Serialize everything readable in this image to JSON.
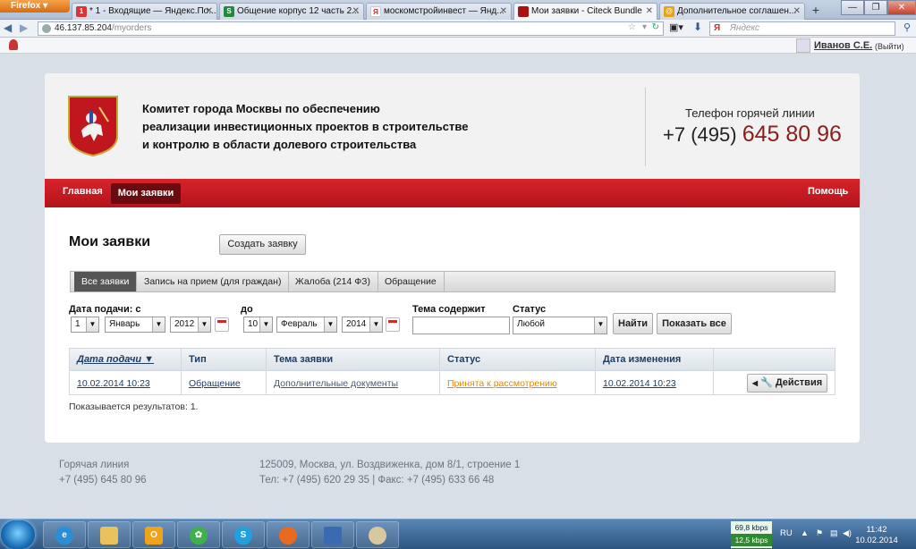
{
  "browser": {
    "app_button": "Firefox",
    "tabs": [
      {
        "title": "* 1 - Входящие — Яндекс.По...",
        "icon": "yandex-mail-icon"
      },
      {
        "title": "Общение корпус 12 часть 2...",
        "icon": "green-s-icon"
      },
      {
        "title": "москомстройинвест — Янд...",
        "icon": "yandex-icon"
      },
      {
        "title": "Мои заявки - Citeck Bundle",
        "icon": "moscow-crest-icon"
      },
      {
        "title": "Дополнительное соглашен...",
        "icon": "at-icon"
      }
    ],
    "new_tab": "+",
    "url_host": "46.137.85.204",
    "url_path": "/myorders",
    "search_placeholder": "Яндекс",
    "user_name": "Иванов С.Е.",
    "logout": "(Выйти)"
  },
  "site": {
    "org_lines": [
      "Комитет города Москвы по обеспечению",
      "реализации инвестиционных проектов в строительстве",
      "и контролю в области долевого строительства"
    ],
    "hotline_label": "Телефон горячей линии",
    "hotline_prefix": "+7 (495)",
    "hotline_number": "645 80 96",
    "menu": {
      "home": "Главная",
      "orders": "Мои заявки",
      "help": "Помощь"
    },
    "page_title": "Мои заявки",
    "create_button": "Создать заявку",
    "subtabs": [
      "Все заявки",
      "Запись на прием (для граждан)",
      "Жалоба (214 ФЗ)",
      "Обращение"
    ],
    "filters": {
      "date_from_label": "Дата подачи: с",
      "date_to_label": "до",
      "from_day": "1",
      "from_month": "Январь",
      "from_year": "2012",
      "to_day": "10",
      "to_month": "Февраль",
      "to_year": "2014",
      "topic_label": "Тема содержит",
      "topic_value": "",
      "status_label": "Статус",
      "status_value": "Любой",
      "find_button": "Найти",
      "show_all_button": "Показать все"
    },
    "table": {
      "headers": [
        "Дата подачи ▼",
        "Тип",
        "Тема заявки",
        "Статус",
        "Дата изменения"
      ],
      "rows": [
        {
          "date": "10.02.2014 10:23",
          "type": "Обращение",
          "topic": "Дополнительные документы",
          "status": "Принята к рассмотрению",
          "changed": "10.02.2014 10:23",
          "action": "Действия"
        }
      ]
    },
    "results_text": "Показывается результатов: 1.",
    "footer": {
      "hotline_title": "Горячая линия",
      "hotline_phone": "+7 (495) 645 80 96",
      "address": "125009, Москва, ул. Воздвиженка, дом 8/1, строение 1",
      "contacts": "Тел: +7 (495) 620 29 35 | Факс: +7 (495) 633 66 48"
    }
  },
  "taskbar": {
    "net_down": "69,8 kbps",
    "net_up": "12,5 kbps",
    "lang": "RU",
    "time": "11:42",
    "date": "10.02.2014"
  },
  "colors": {
    "brand_red": "#c41a21",
    "dark_red": "#8b1d1d",
    "link_blue": "#1f3d63",
    "status_orange": "#e08a00"
  }
}
